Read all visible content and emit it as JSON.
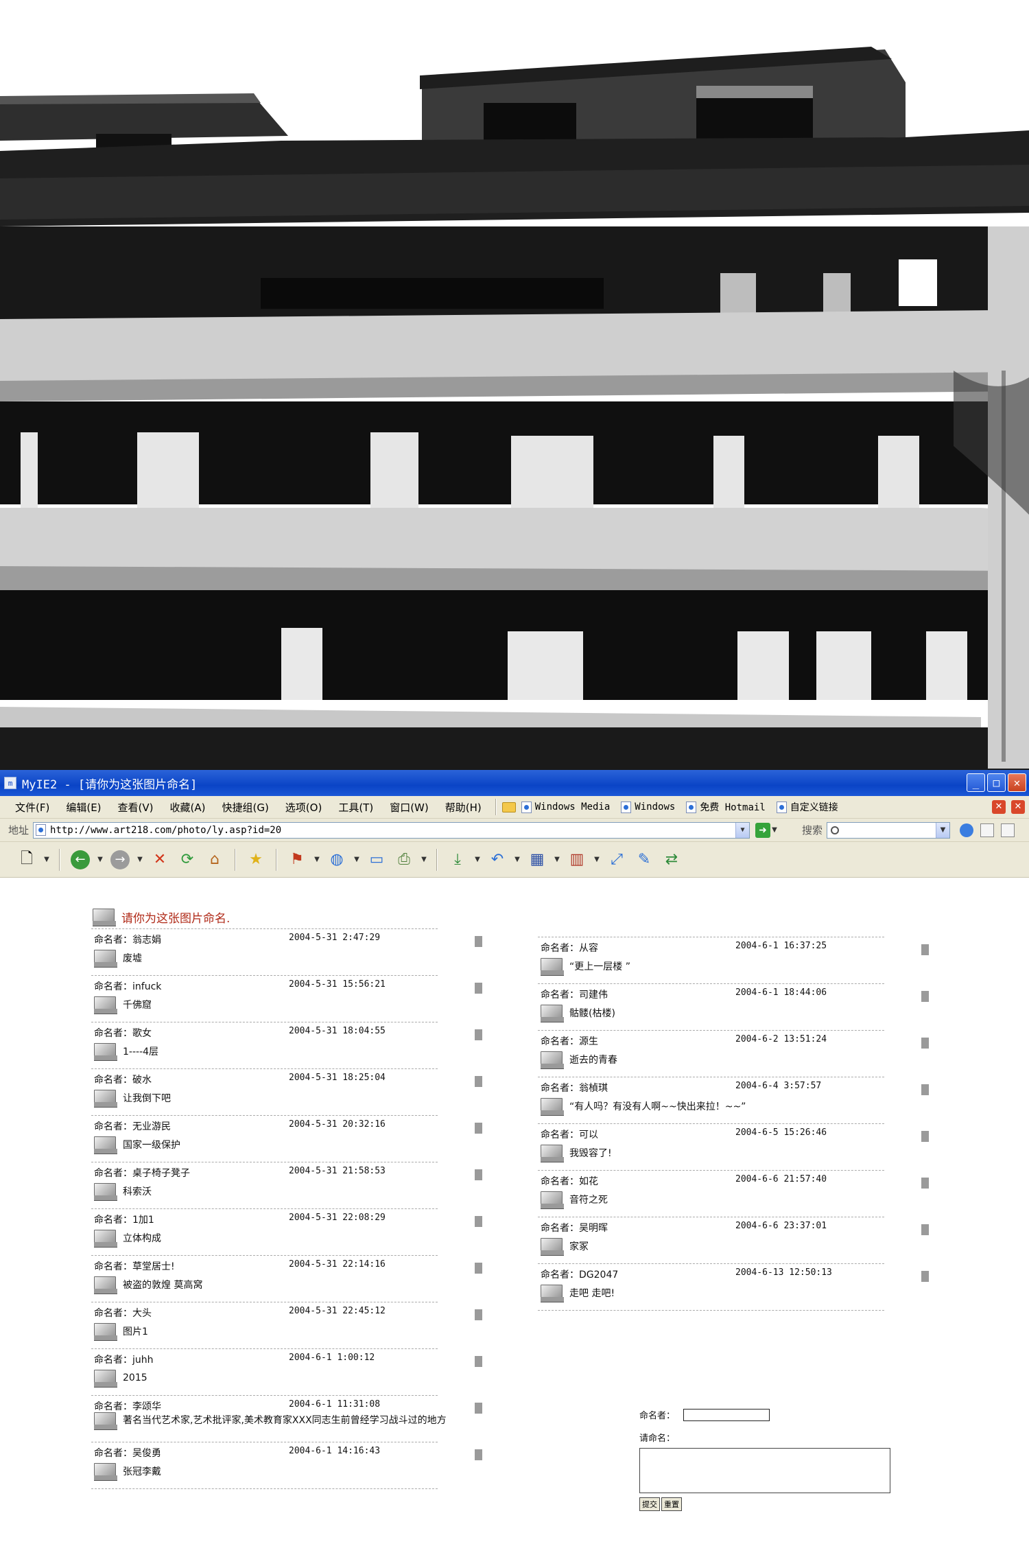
{
  "window": {
    "title": "MyIE2 - [请你为这张图片命名]"
  },
  "menu": {
    "items": [
      "文件(F)",
      "编辑(E)",
      "查看(V)",
      "收藏(A)",
      "快捷组(G)",
      "选项(O)",
      "工具(T)",
      "窗口(W)",
      "帮助(H)"
    ],
    "links": [
      "Windows Media",
      "Windows",
      "免费 Hotmail",
      "自定义链接"
    ]
  },
  "address": {
    "label": "地址",
    "url": "http://www.art218.com/photo/ly.asp?id=20",
    "search_label": "搜索"
  },
  "page": {
    "topic": "请你为这张图片命名.",
    "name_prefix": "命名者：",
    "left_entries": [
      {
        "author": "翁志娟",
        "time": "2004-5-31 2:47:29",
        "name": "废墟"
      },
      {
        "author": "infuck",
        "time": "2004-5-31 15:56:21",
        "name": "千佛窟"
      },
      {
        "author": "歌女",
        "time": "2004-5-31 18:04:55",
        "name": "1----4层"
      },
      {
        "author": "破水",
        "time": "2004-5-31 18:25:04",
        "name": "让我倒下吧"
      },
      {
        "author": "无业游民",
        "time": "2004-5-31 20:32:16",
        "name": "国家一级保护"
      },
      {
        "author": "桌子椅子凳子",
        "time": "2004-5-31 21:58:53",
        "name": "科索沃"
      },
      {
        "author": "1加1",
        "time": "2004-5-31 22:08:29",
        "name": "立体构成"
      },
      {
        "author": "草堂居士!",
        "time": "2004-5-31 22:14:16",
        "name": "被盗的敦煌 莫高窝"
      },
      {
        "author": "大头",
        "time": "2004-5-31 22:45:12",
        "name": "图片1"
      },
      {
        "author": "juhh",
        "time": "2004-6-1 1:00:12",
        "name": "2015"
      },
      {
        "author": "李颂华",
        "time": "2004-6-1 11:31:08",
        "name": "著名当代艺术家,艺术批评家,美术教育家XXX同志生前曾经学习战斗过的地方"
      },
      {
        "author": "吴俊勇",
        "time": "2004-6-1 14:16:43",
        "name": "张冠李戴"
      }
    ],
    "right_entries": [
      {
        "author": "从容",
        "time": "2004-6-1 16:37:25",
        "name": "“更上一层楼 ”"
      },
      {
        "author": "司建伟",
        "time": "2004-6-1 18:44:06",
        "name": "骷髅(枯楼)"
      },
      {
        "author": "源生",
        "time": "2004-6-2 13:51:24",
        "name": "逝去的青春"
      },
      {
        "author": "翁楨琪",
        "time": "2004-6-4 3:57:57",
        "name": "“有人吗？有没有人啊~~快出来拉！~~”"
      },
      {
        "author": "可以",
        "time": "2004-6-5 15:26:46",
        "name": "我毁容了!"
      },
      {
        "author": "如花",
        "time": "2004-6-6 21:57:40",
        "name": "音符之死"
      },
      {
        "author": "吴明晖",
        "time": "2004-6-6 23:37:01",
        "name": "家冢"
      },
      {
        "author": "DG2047",
        "time": "2004-6-13 12:50:13",
        "name": "走吧 走吧!"
      }
    ]
  },
  "form": {
    "name_label": "命名者：",
    "title_label": "请命名：",
    "submit_label": "提交",
    "reset_label": "重置"
  },
  "colors": {
    "titlebar": "#0a44c6",
    "chrome": "#ece9d8",
    "topic": "#b02a18"
  }
}
